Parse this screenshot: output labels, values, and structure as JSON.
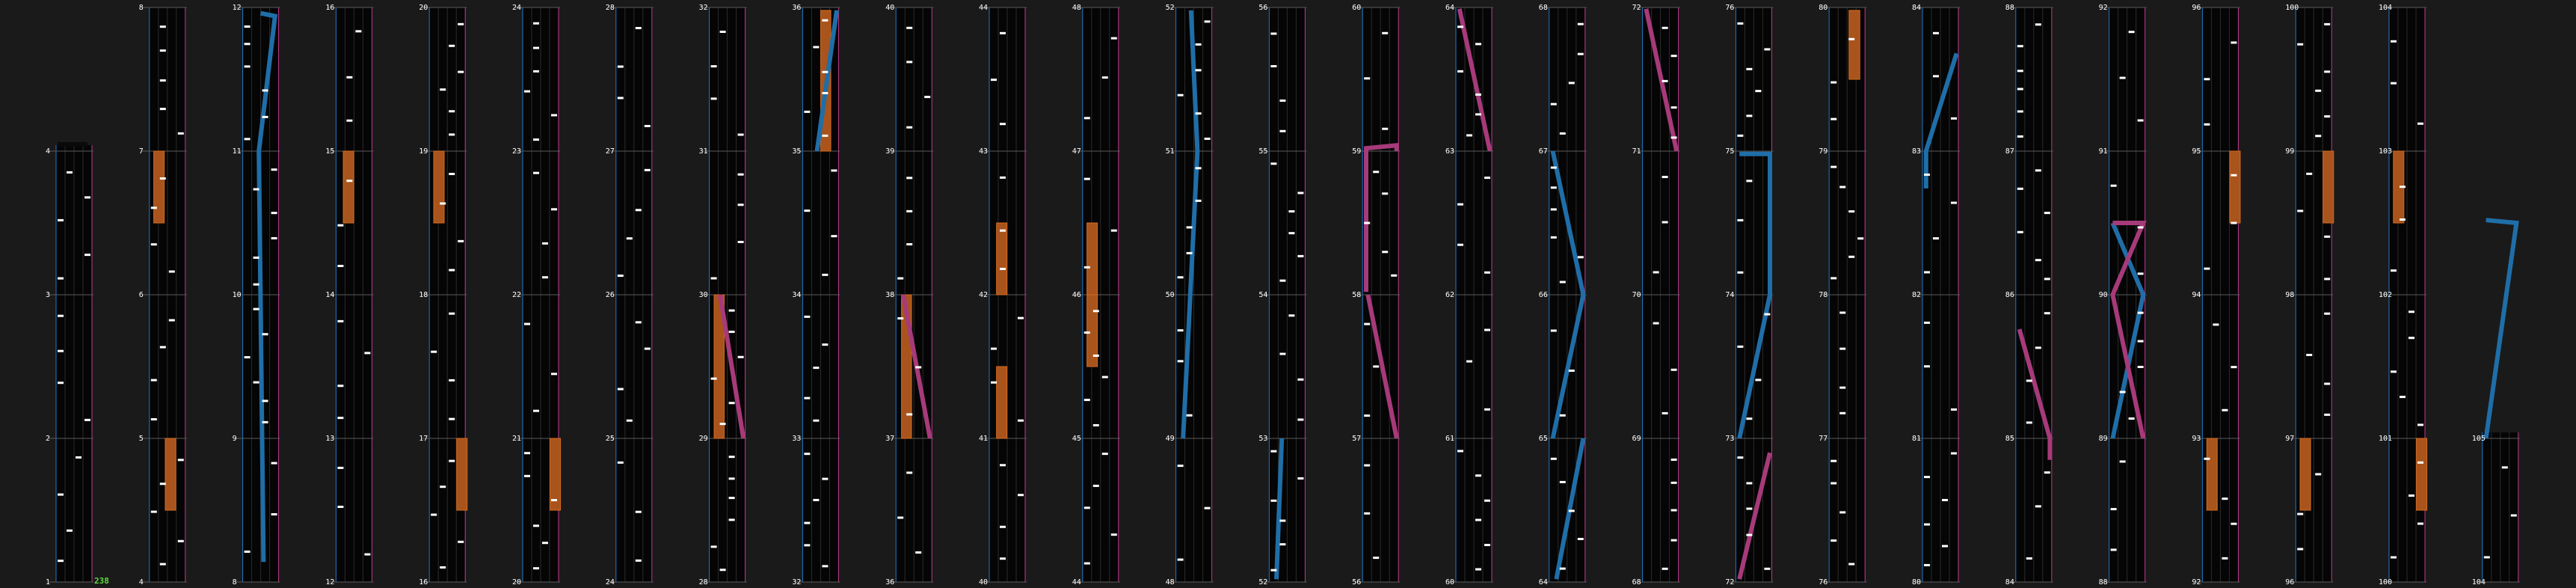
{
  "chart_meta": {
    "combo_count": "238",
    "colors": {
      "background": "#1a1a1a",
      "lane_bg": "#050505",
      "grid": "#2b2b2b",
      "left_line": "#1e78c8",
      "right_line": "#c23a8c",
      "measure_line": "#5a5a5a",
      "blue_slide": "#1f6ea8",
      "pink_slide": "#a73a7a",
      "hold": "#a8541c",
      "tap": "#ffffff",
      "combo_text": "#5ddc3c"
    }
  },
  "columns": [
    {
      "labels": [
        "1",
        "2",
        "3",
        "4"
      ],
      "notes": []
    },
    {
      "labels": [
        "4",
        "5",
        "6",
        "7",
        "8"
      ],
      "notes": []
    },
    {
      "labels": [
        "8",
        "9",
        "10",
        "11",
        "12"
      ],
      "notes": []
    },
    {
      "labels": [
        "12",
        "13",
        "14",
        "15",
        "16"
      ],
      "notes": []
    },
    {
      "labels": [
        "16",
        "17",
        "18",
        "19",
        "20"
      ],
      "notes": []
    },
    {
      "labels": [
        "20",
        "21",
        "22",
        "23",
        "24"
      ],
      "notes": []
    },
    {
      "labels": [
        "24",
        "25",
        "26",
        "27",
        "28"
      ],
      "notes": []
    },
    {
      "labels": [
        "28",
        "29",
        "30",
        "31",
        "32"
      ],
      "notes": []
    },
    {
      "labels": [
        "32",
        "33",
        "34",
        "35",
        "36"
      ],
      "notes": []
    },
    {
      "labels": [
        "36",
        "37",
        "38",
        "39",
        "40"
      ],
      "notes": []
    },
    {
      "labels": [
        "40",
        "41",
        "42",
        "43",
        "44"
      ],
      "notes": []
    },
    {
      "labels": [
        "44",
        "45",
        "46",
        "47",
        "48"
      ],
      "notes": []
    },
    {
      "labels": [
        "48",
        "49",
        "50",
        "51",
        "52"
      ],
      "notes": []
    },
    {
      "labels": [
        "52",
        "53",
        "54",
        "55",
        "56"
      ],
      "notes": []
    },
    {
      "labels": [
        "56",
        "57",
        "58",
        "59",
        "60"
      ],
      "notes": []
    },
    {
      "labels": [
        "60",
        "61",
        "62",
        "63",
        "64"
      ],
      "notes": []
    },
    {
      "labels": [
        "64",
        "65",
        "66",
        "67",
        "68"
      ],
      "notes": []
    },
    {
      "labels": [
        "68",
        "69",
        "70",
        "71",
        "72"
      ],
      "notes": []
    },
    {
      "labels": [
        "72",
        "73",
        "74",
        "75",
        "76"
      ],
      "notes": []
    },
    {
      "labels": [
        "76",
        "77",
        "78",
        "79",
        "80"
      ],
      "notes": []
    },
    {
      "labels": [
        "80",
        "81",
        "82",
        "83",
        "84"
      ],
      "notes": []
    },
    {
      "labels": [
        "84",
        "85",
        "86",
        "87",
        "88"
      ],
      "notes": []
    },
    {
      "labels": [
        "88",
        "89",
        "90",
        "91",
        "92"
      ],
      "notes": []
    },
    {
      "labels": [
        "92",
        "93",
        "94",
        "95",
        "96"
      ],
      "notes": []
    },
    {
      "labels": [
        "96",
        "97",
        "98",
        "99",
        "100"
      ],
      "notes": []
    },
    {
      "labels": [
        "100",
        "101",
        "102",
        "103",
        "104"
      ],
      "notes": []
    },
    {
      "labels": [
        "104",
        "105"
      ],
      "notes": []
    }
  ]
}
